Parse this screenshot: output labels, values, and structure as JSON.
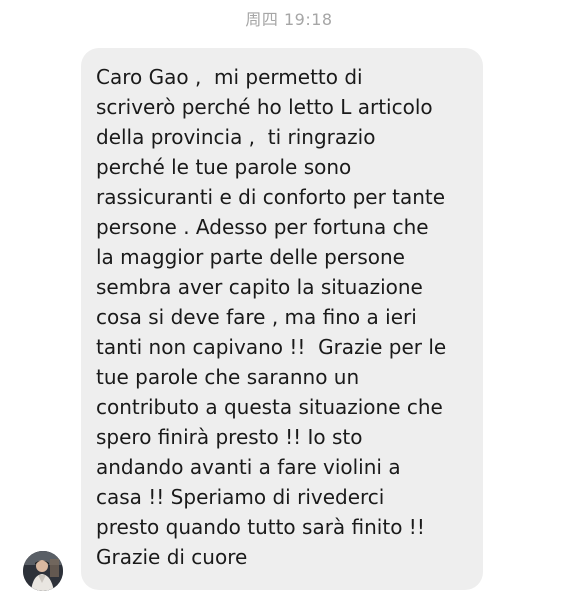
{
  "chat": {
    "timestamp": "周四 19:18",
    "message": {
      "lines": [
        "Caro Gao ,  mi permetto di",
        "scriverò perché ho letto L articolo",
        "della provincia ,  ti ringrazio",
        "perché le tue parole sono",
        "rassicuranti e di conforto per tante",
        "persone . Adesso per fortuna che",
        "la maggior parte delle persone",
        "sembra aver capito la situazione",
        "cosa si deve fare , ma fino a ieri",
        "tanti non capivano !!  Grazie per le",
        "tue parole che saranno un",
        "contributo a questa situazione che",
        "spero finirà presto !! Io sto",
        "andando avanti a fare violini a",
        "casa !! Speriamo di rivederci",
        "presto quando tutto sarà finito !!",
        "Grazie di cuore"
      ]
    },
    "colors": {
      "bubble_background": "#eeeeee",
      "timestamp_text": "#a6a6a6",
      "message_text": "#1a1a1a"
    },
    "sender_avatar_icon": "person-photo-icon"
  }
}
